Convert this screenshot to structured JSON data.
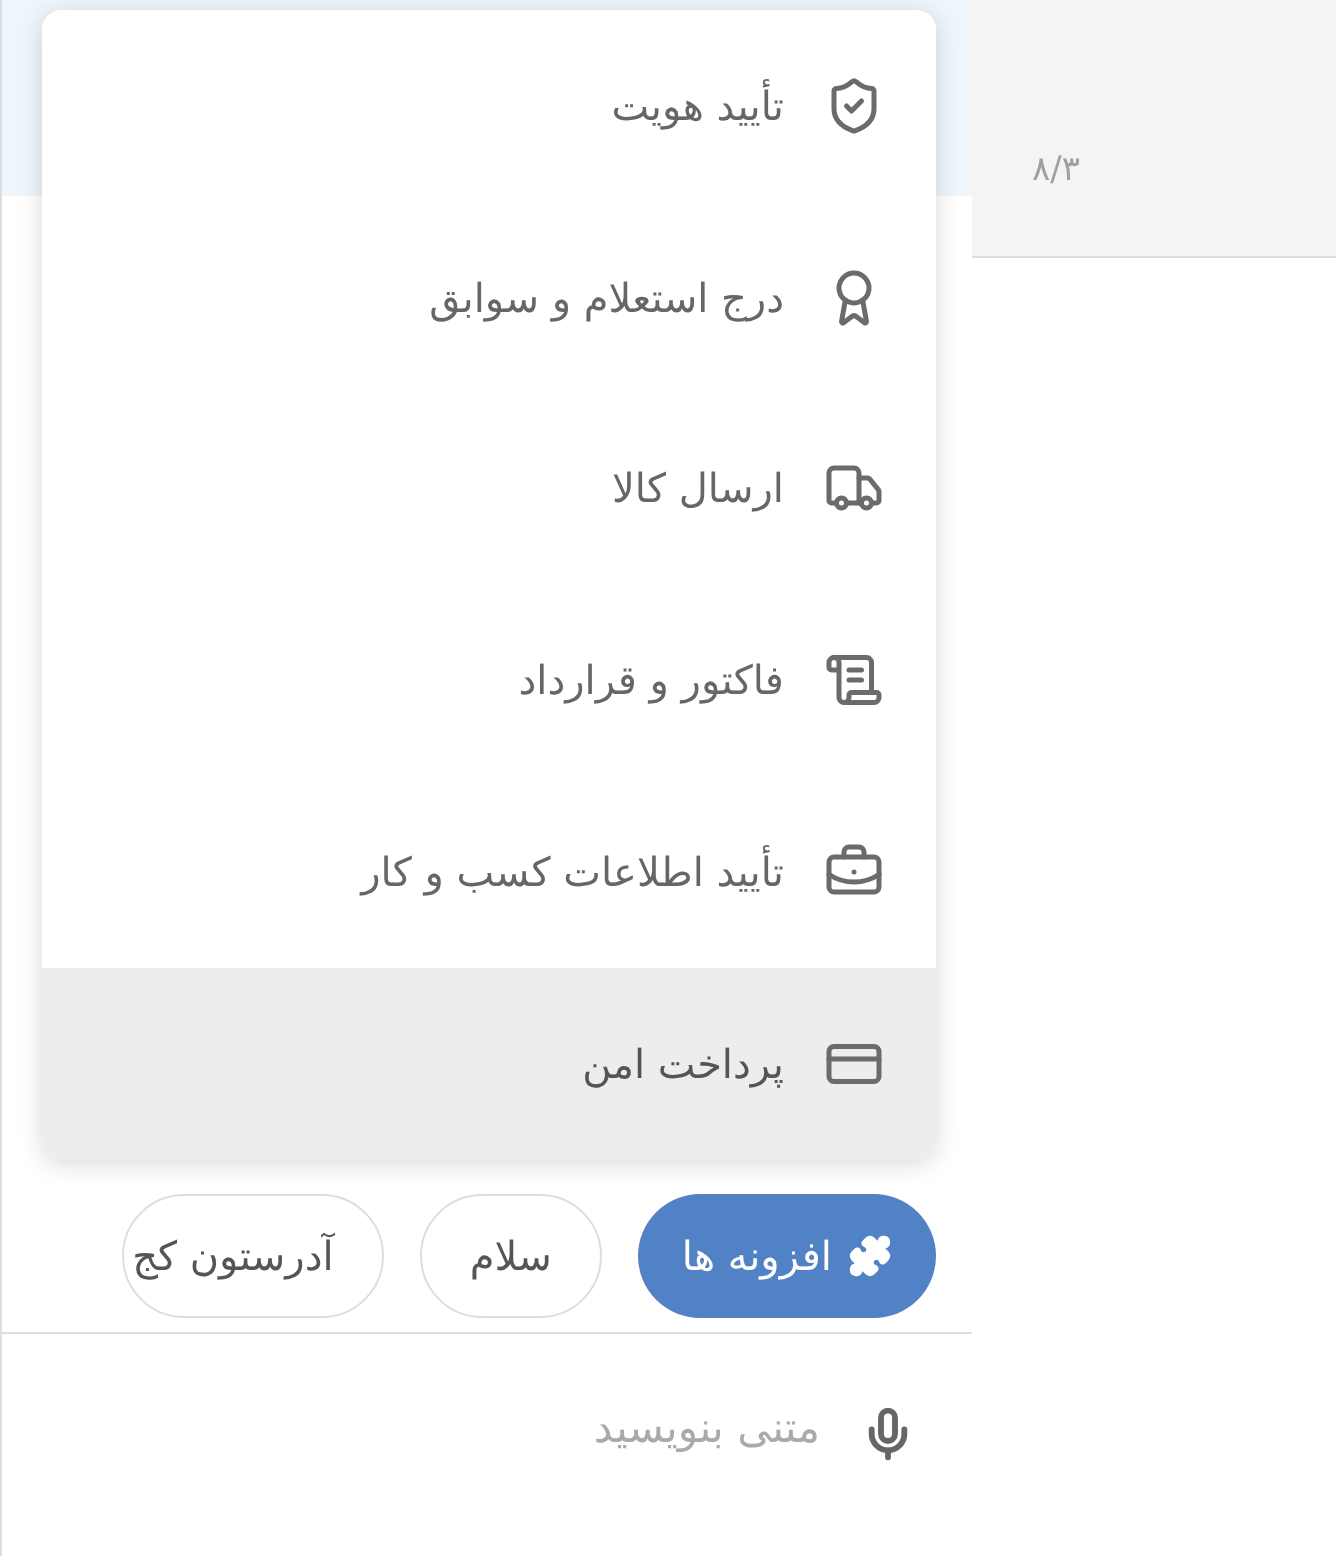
{
  "side_panel": {
    "time": "۸/۳"
  },
  "menu": {
    "items": [
      {
        "label": "تأیید هویت",
        "selected": false
      },
      {
        "label": "درج استعلام و سوابق",
        "selected": false
      },
      {
        "label": "ارسال کالا",
        "selected": false
      },
      {
        "label": "فاکتور و قرارداد",
        "selected": false
      },
      {
        "label": "تأیید اطلاعات کسب و کار",
        "selected": false
      },
      {
        "label": "پرداخت امن",
        "selected": true
      }
    ]
  },
  "chips": [
    {
      "kind": "plugins",
      "label": "افزونه ها"
    },
    {
      "kind": "suggestion",
      "label": "سلام"
    },
    {
      "kind": "suggestion",
      "label": "آدرستون کج"
    }
  ],
  "composer": {
    "placeholder": "متنی بنویسید"
  }
}
